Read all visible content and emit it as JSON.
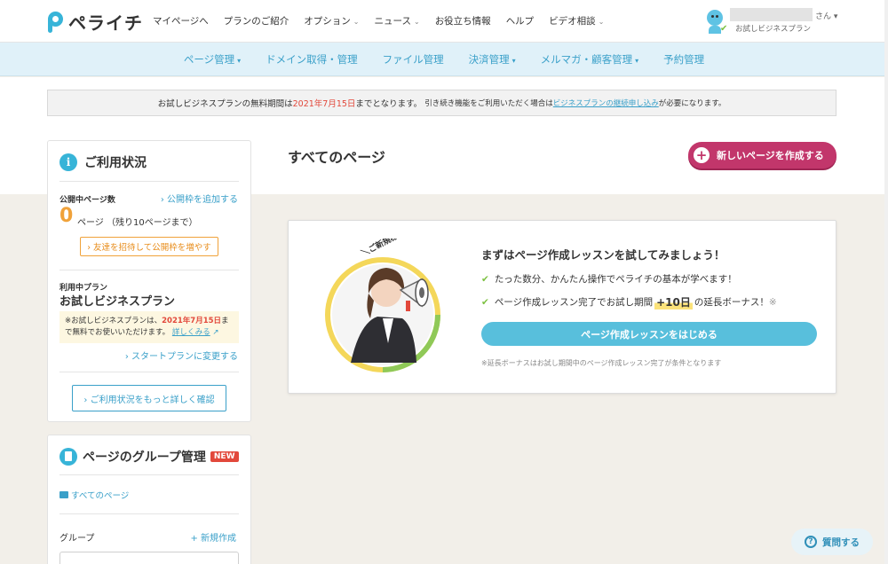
{
  "header": {
    "logo_text": "ペライチ",
    "nav": [
      {
        "label": "マイページへ",
        "has_dropdown": false
      },
      {
        "label": "プランのご紹介",
        "has_dropdown": false
      },
      {
        "label": "オプション",
        "has_dropdown": true
      },
      {
        "label": "ニュース",
        "has_dropdown": true
      },
      {
        "label": "お役立ち情報",
        "has_dropdown": false
      },
      {
        "label": "ヘルプ",
        "has_dropdown": false
      },
      {
        "label": "ビデオ相談",
        "has_dropdown": true
      }
    ],
    "user": {
      "honorific": "さん",
      "plan": "お試しビジネスプラン"
    }
  },
  "subnav": [
    {
      "label": "ページ管理",
      "has_dropdown": true
    },
    {
      "label": "ドメイン取得・管理",
      "has_dropdown": false
    },
    {
      "label": "ファイル管理",
      "has_dropdown": false
    },
    {
      "label": "決済管理",
      "has_dropdown": true
    },
    {
      "label": "メルマガ・顧客管理",
      "has_dropdown": true
    },
    {
      "label": "予約管理",
      "has_dropdown": false
    }
  ],
  "notice": {
    "text_before": "お試しビジネスプランの無料期間は",
    "date": "2021年7月15日",
    "text_after": "までとなります。",
    "small_before": "引き続き機能をご利用いただく場合は",
    "link": "ビジネスプランの継続申し込み",
    "small_after": "が必要になります。"
  },
  "usage_card": {
    "title": "ご利用状況",
    "pages_label": "公開中ページ数",
    "add_link": "› 公開枠を追加する",
    "count": "0",
    "count_text": "ページ （残り10ページまで）",
    "invite_button": "› 友達を招待して公開枠を増やす",
    "plan_label": "利用中プラン",
    "plan_name": "お試しビジネスプラン",
    "trial_before": "※お試しビジネスプランは、",
    "trial_date": "2021年7月15日",
    "trial_after": "まで無料でお使いいただけます。",
    "trial_link": "詳しくみる",
    "change_link": "› スタートプランに変更する",
    "detail_button": "› ご利用状況をもっと詳しく確認"
  },
  "group_card": {
    "title": "ページのグループ管理",
    "badge": "NEW",
    "all_pages": "すべてのページ",
    "group_label": "グループ",
    "new_create": "+ 新規作成"
  },
  "main": {
    "title": "すべてのページ",
    "create_button": "新しいページを作成する",
    "lesson": {
      "badge_text": "＼ご新規様応援／",
      "title": "まずはページ作成レッスンを試してみましょう！",
      "bullet1": "たった数分、かんたん操作でペライチの基本が学べます！",
      "bullet2_before": "ページ作成レッスン完了でお試し期間",
      "bullet2_highlight": "+10日",
      "bullet2_after": "の延長ボーナス！",
      "bullet2_mark": "※",
      "button": "ページ作成レッスンをはじめる",
      "footnote": "※延長ボーナスはお試し期間中のページ作成レッスン完了が条件となります"
    }
  },
  "help_button": "質問する",
  "colors": {
    "brand": "#37b4d8",
    "accent_pink": "#c2366b",
    "orange": "#f0a23a",
    "red": "#e2483b"
  }
}
